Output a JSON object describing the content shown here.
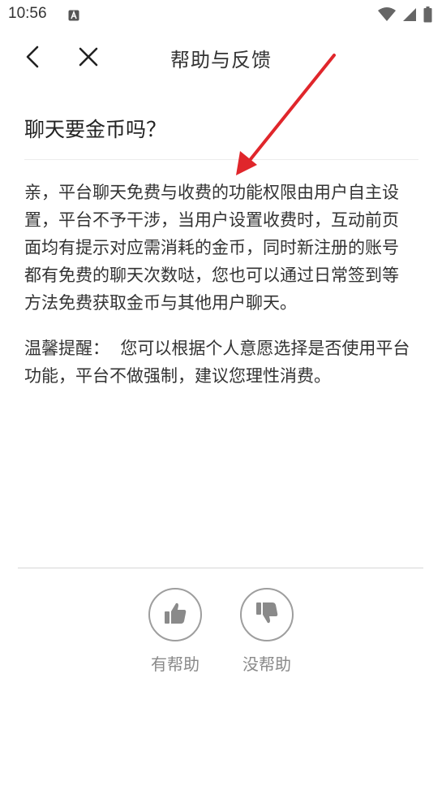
{
  "status_bar": {
    "time": "10:56",
    "icons": [
      "app-notification-icon",
      "wifi-icon",
      "signal-icon",
      "battery-icon"
    ]
  },
  "nav": {
    "title": "帮助与反馈",
    "back_icon": "chevron-left-icon",
    "close_icon": "close-icon"
  },
  "article": {
    "question": "聊天要金币吗？",
    "answer_lines": [
      "亲，平台聊天免费与收费的功能权限由用户自主设",
      "置，平台不予干涉，当用户设置收费时，互动前页",
      "面均有提示对应需消耗的金币，同时新注册的账号",
      "都有免费的聊天次数哒，您也可以通过日常签到等",
      "方法免费获取金币与其他用户聊天。"
    ],
    "reminder_lines": [
      "温馨提醒：  您可以根据个人意愿选择是否使用平台",
      "功能，平台不做强制，建议您理性消费。"
    ]
  },
  "feedback": {
    "helpful_label": "有帮助",
    "unhelpful_label": "没帮助",
    "helpful_icon": "thumbs-up-icon",
    "unhelpful_icon": "thumbs-down-icon"
  },
  "annotation": {
    "arrow_color": "#e0262b"
  }
}
